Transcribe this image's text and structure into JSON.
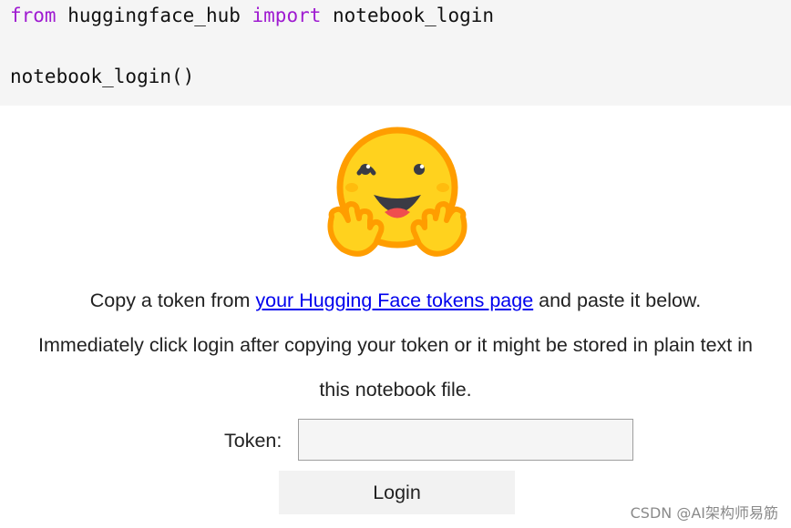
{
  "code": {
    "line1": {
      "kw_from": "from",
      "module": " huggingface_hub ",
      "kw_import": "import",
      "name": " notebook_login"
    },
    "line2": "notebook_login()"
  },
  "output": {
    "logo_icon": "hugging-face-emoji",
    "intro_before_link": "Copy a token from ",
    "link_text": "your Hugging Face tokens page",
    "intro_after_link": " and paste it below.",
    "warning_line1": "Immediately click login after copying your token or it might be stored in plain text in",
    "warning_line2": "this notebook file.",
    "token_label": "Token:",
    "token_value": "",
    "login_label": "Login"
  },
  "watermark": "CSDN @AI架构师易筋",
  "colors": {
    "keyword": "#9f1bd1",
    "link": "#0000ee",
    "code_bg": "#f5f5f5",
    "emoji_face": "#ffd21e",
    "emoji_outline": "#ff9d00"
  }
}
